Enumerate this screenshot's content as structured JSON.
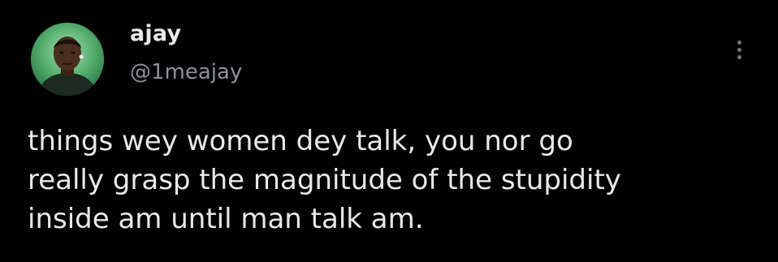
{
  "author": {
    "display_name": "ajay",
    "handle": "@1meajay",
    "avatar_icon": "profile-photo"
  },
  "tweet": {
    "lines": [
      "things wey women dey talk, you nor go",
      "really grasp the magnitude of the stupidity",
      "inside am until man talk am."
    ]
  },
  "menu": {
    "icon": "more-vertical-icon"
  },
  "colors": {
    "background": "#000000",
    "text": "#e7e9ea",
    "muted": "#8b9299",
    "avatar_bg": "#4fae6c"
  }
}
